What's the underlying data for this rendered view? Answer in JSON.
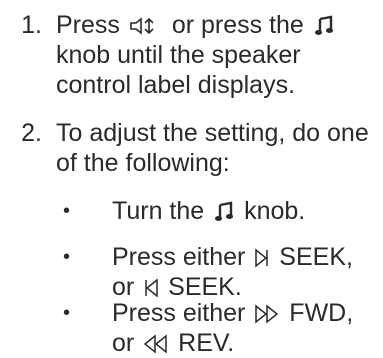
{
  "steps": [
    {
      "number": "1.",
      "text_1": "Press",
      "text_2": "or press the",
      "text_3": "knob until the speaker control label displays."
    },
    {
      "number": "2.",
      "text": "To adjust the setting, do one of the following:"
    }
  ],
  "bullets": [
    {
      "marker": "•",
      "text_1": "Turn the",
      "text_2": "knob."
    },
    {
      "marker": "•",
      "text_1": "Press either",
      "text_2": "SEEK,",
      "text_3": "or",
      "text_4": "SEEK."
    },
    {
      "marker": "•",
      "text_1": "Press either",
      "text_2": "FWD,",
      "text_3": "or",
      "text_4": "REV."
    }
  ],
  "icons": {
    "speaker_adjust": "speaker-adjust-icon",
    "music_note": "music-note-icon",
    "seek_next": "seek-next-icon",
    "seek_prev": "seek-prev-icon",
    "fast_forward": "fast-forward-icon",
    "rewind": "rewind-icon"
  }
}
